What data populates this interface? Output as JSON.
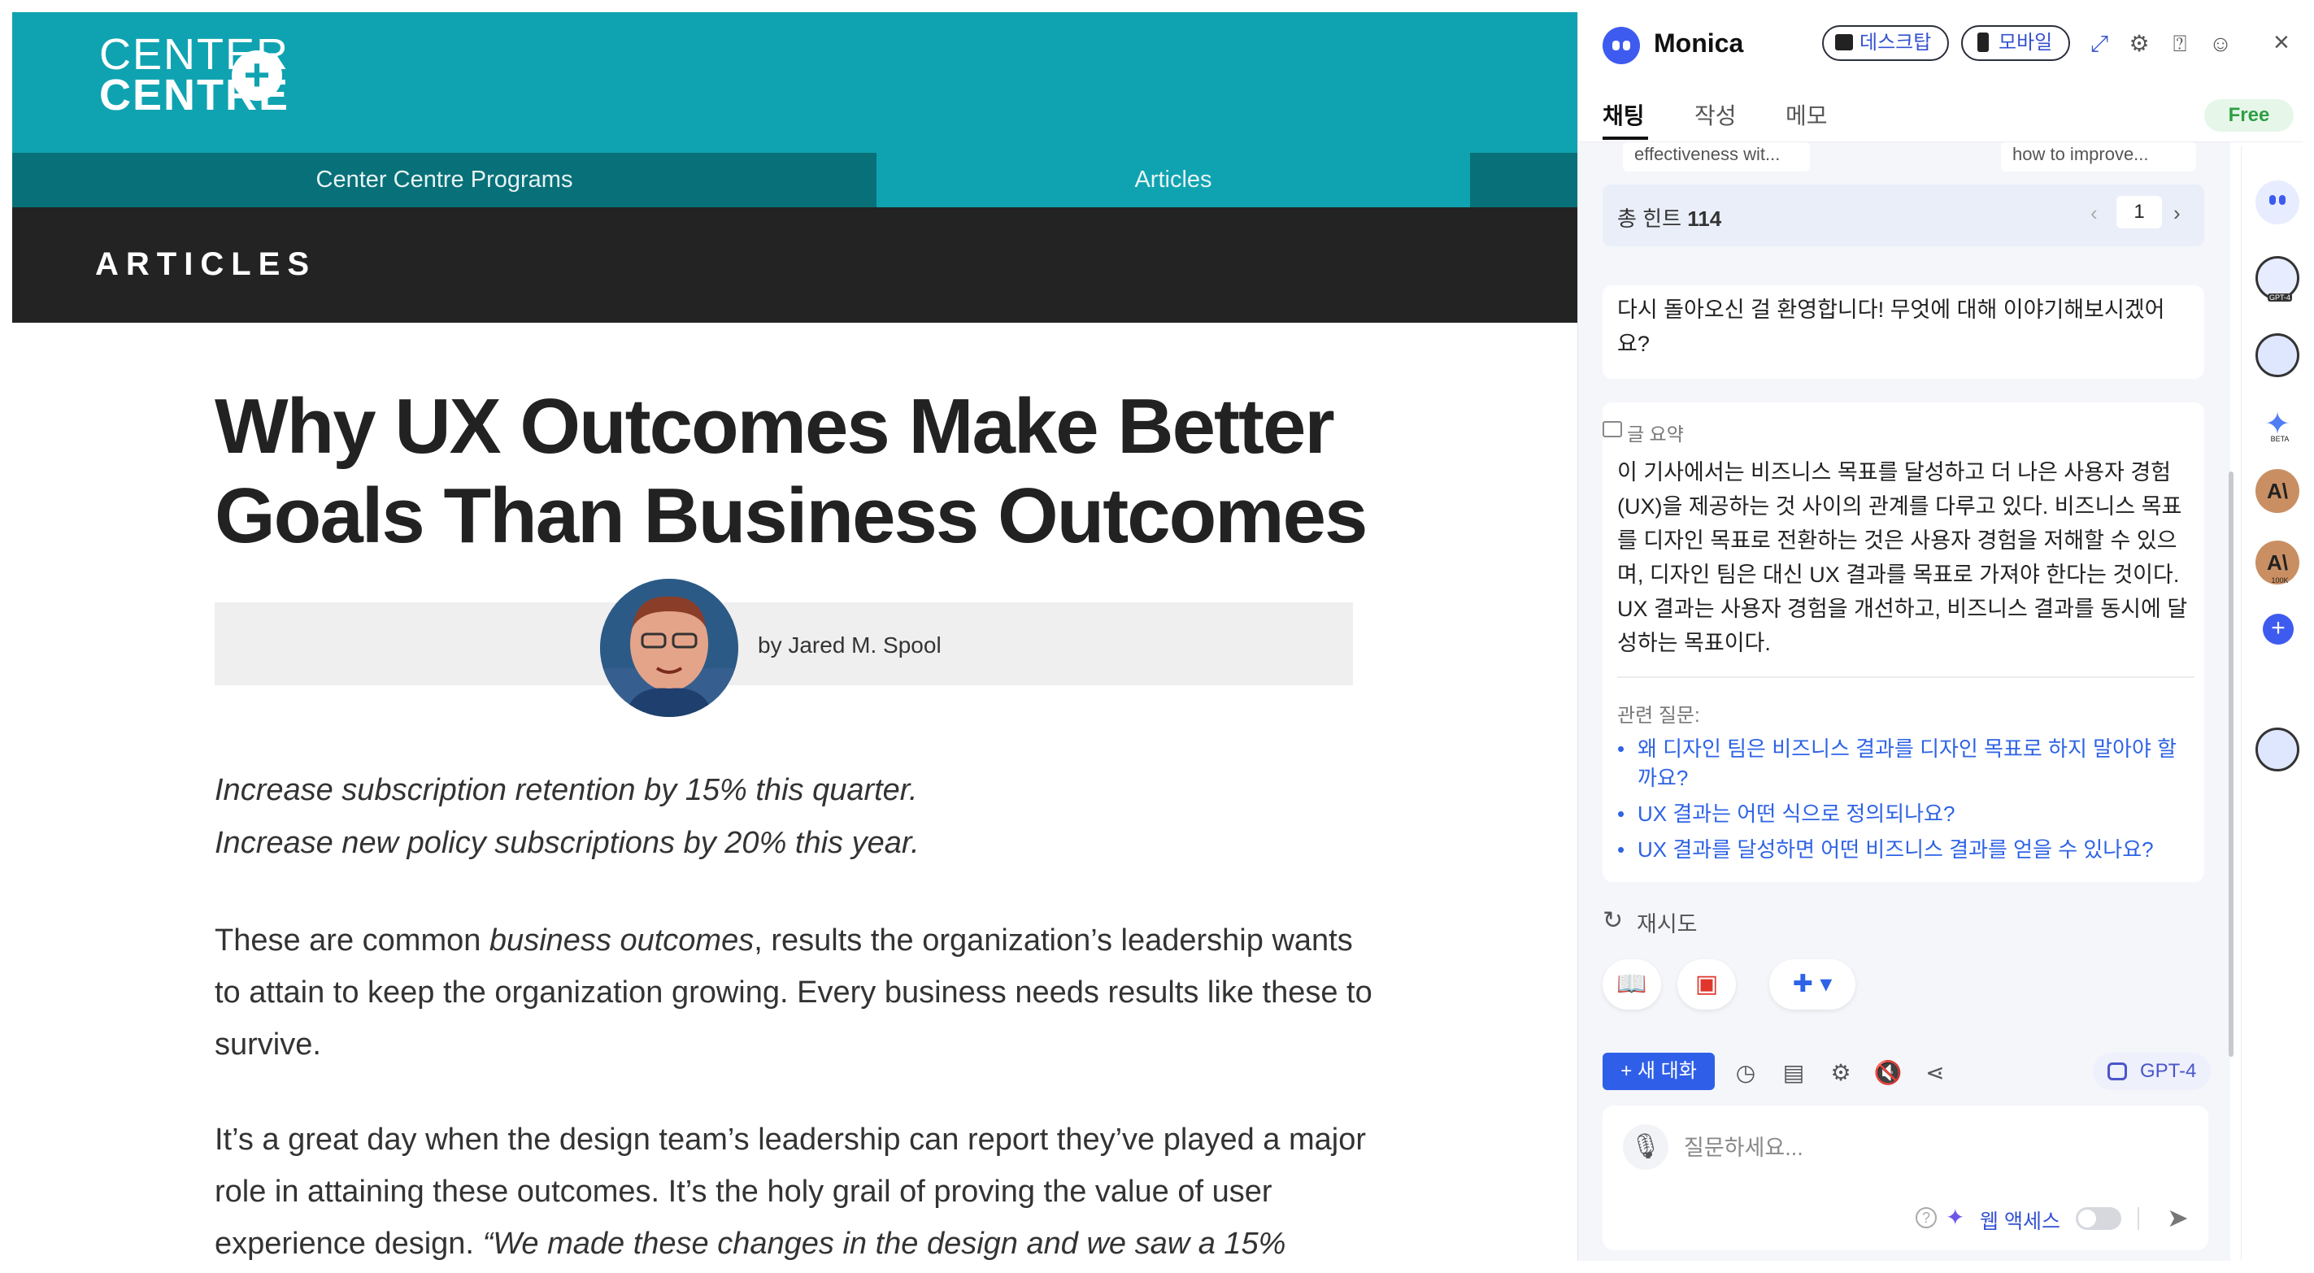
{
  "site": {
    "logo_line1": "CENTER",
    "logo_line2": "CENTRE",
    "logo_plus": "+",
    "nav": [
      "Center Centre Programs",
      "Articles"
    ],
    "section_label": "ARTICLES"
  },
  "article": {
    "title": "Why UX Outcomes Make Better Goals Than Business Outcomes",
    "byline": "by Jared M. Spool",
    "intro": [
      "Increase subscription retention by 15% this quarter.",
      "Increase new policy subscriptions by 20% this year."
    ],
    "para1_before": "These are common ",
    "para1_em": "business outcomes",
    "para1_after": ", results the organization’s leadership wants to attain to keep the organization growing. Every business needs results like these to survive.",
    "para2_before": "It’s a great day when the design team’s leadership can report they’ve played a major role in attaining these outcomes. It’s the holy grail of proving the value of user experience design. ",
    "para2_em": "“We made these changes in the design and we saw a 15%"
  },
  "monica": {
    "title": "Monica",
    "desktop": "데스크탑",
    "mobile": "모바일",
    "tabs": [
      "채팅",
      "작성",
      "메모"
    ],
    "plan_badge": "Free",
    "hint_chip_a": "effectiveness wit...",
    "hint_chip_b": "how to improve...",
    "hint_total_label": "총 힌트",
    "hint_total_count": "114",
    "hint_page": "1",
    "welcome": "다시 돌아오신 걸 환영합니다! 무엇에 대해 이야기해보시겠어요?",
    "summary_label": "글 요약",
    "summary": "이 기사에서는 비즈니스 목표를 달성하고 더 나은 사용자 경험(UX)을 제공하는 것 사이의 관계를 다루고 있다. 비즈니스 목표를 디자인 목표로 전환하는 것은 사용자 경험을 저해할 수 있으며, 디자인 팀은 대신 UX 결과를 목표로 가져야 한다는 것이다. UX 결과는 사용자 경험을 개선하고, 비즈니스 결과를 동시에 달성하는 목표이다.",
    "related_label": "관련 질문:",
    "related": [
      "왜 디자인 팀은 비즈니스 결과를 디자인 목표로 하지 말아야 할까요?",
      "UX 결과는 어떤 식으로 정의되나요?",
      "UX 결과를 달성하면 어떤 비즈니스 결과를 얻을 수 있나요?"
    ],
    "retry": "재시도",
    "new_chat": "+ 새 대화",
    "model": "GPT-4",
    "input_placeholder": "질문하세요...",
    "web_access": "웹 액세스",
    "rail_tags": [
      "GPT-4",
      "BETA",
      "100K"
    ],
    "rail_claude": "A\\"
  }
}
